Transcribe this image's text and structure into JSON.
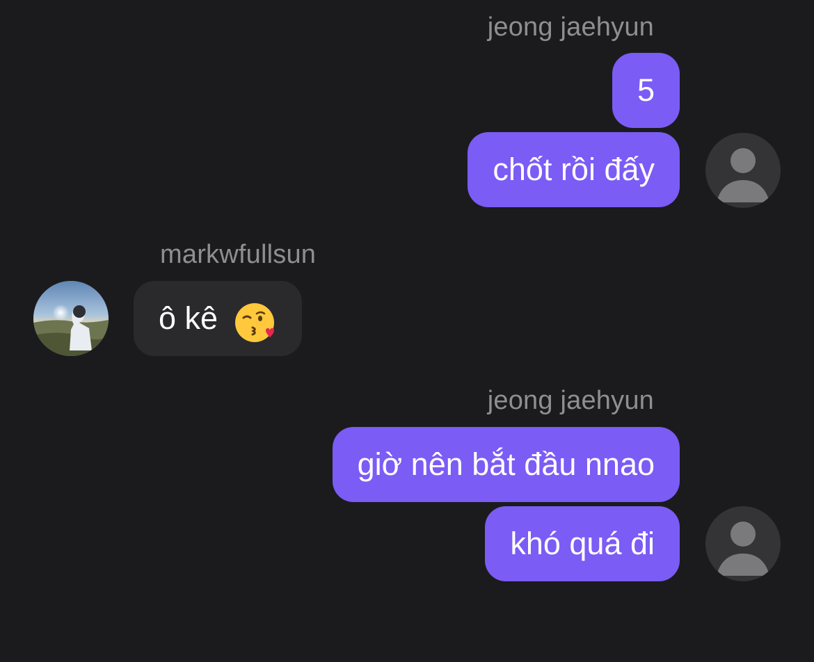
{
  "conversation": {
    "groups": [
      {
        "sender": "jeong jaehyun",
        "direction": "outgoing",
        "messages": [
          "5",
          "chốt rồi đấy"
        ],
        "avatar_icon": "default-user-icon"
      },
      {
        "sender": "markwfullsun",
        "direction": "incoming",
        "messages": [
          "ô kê"
        ],
        "message_emoji": "face-blowing-a-kiss-emoji",
        "avatar_icon": "profile-photo"
      },
      {
        "sender": "jeong jaehyun",
        "direction": "outgoing",
        "messages": [
          "giờ nên bắt đầu nnao",
          "khó quá đi"
        ],
        "avatar_icon": "default-user-icon"
      }
    ]
  },
  "colors": {
    "background": "#1b1b1e",
    "outgoing_bubble": "#7b5cf5",
    "incoming_bubble": "#2a2a2d",
    "sender_name": "#8e8e93",
    "message_text": "#ffffff",
    "default_avatar_bg": "#343436",
    "default_avatar_fg": "#7a7a7c"
  }
}
